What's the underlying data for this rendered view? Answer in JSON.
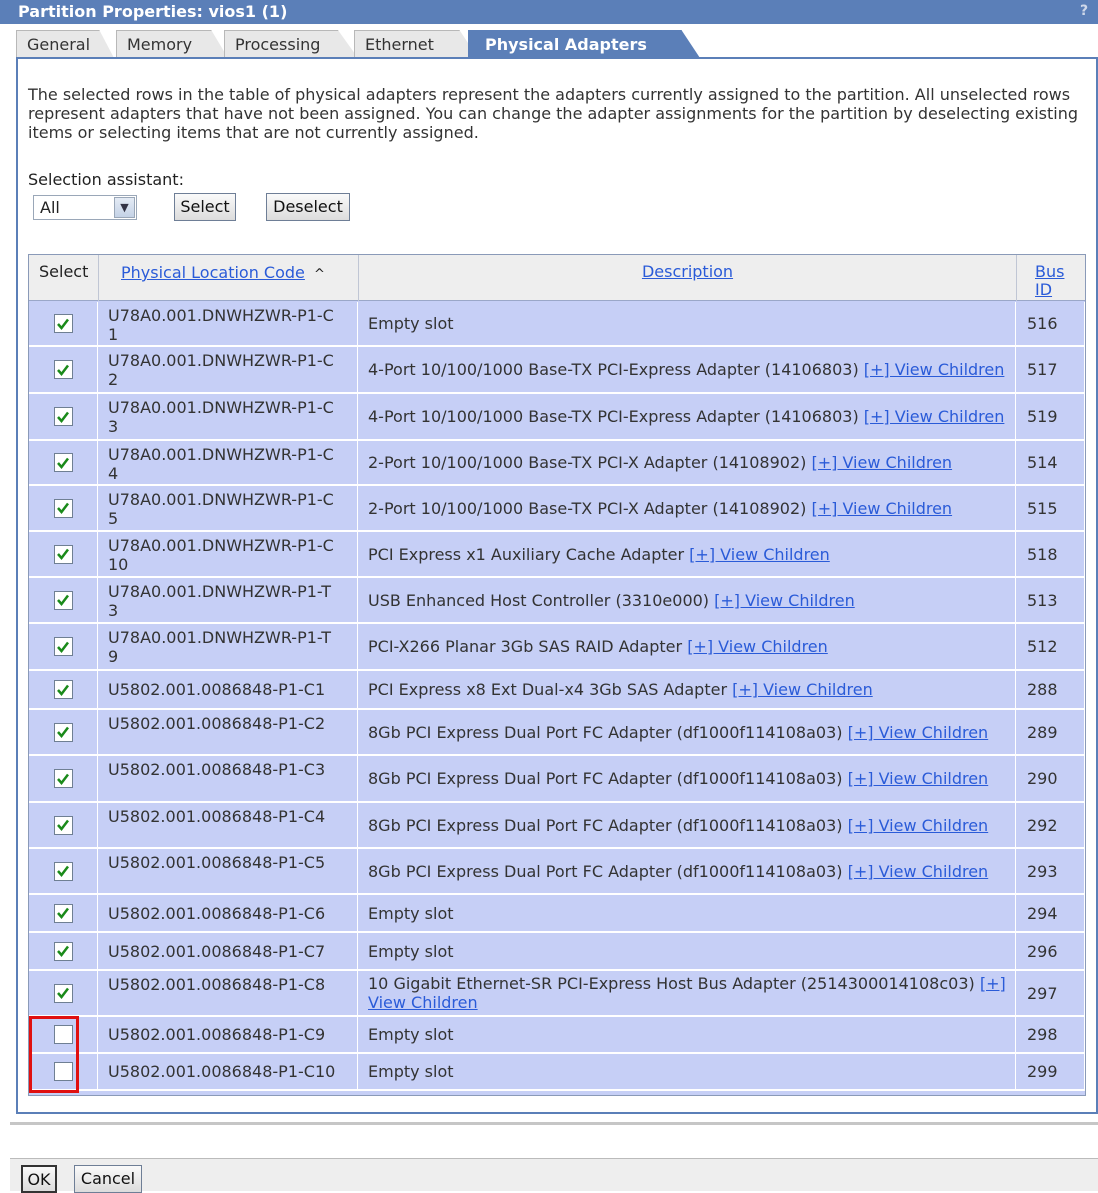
{
  "window": {
    "title": "Partition Properties: vios1 (1)",
    "help": "?"
  },
  "tabs": [
    "General",
    "Memory",
    "Processing",
    "Ethernet",
    "Physical Adapters"
  ],
  "intro": "The selected rows in the table of physical adapters represent the adapters currently assigned to the partition. All unselected rows represent adapters that have not been assigned. You can change the adapter assignments for the partition by deselecting existing items or selecting items that are not currently assigned.",
  "selection": {
    "label": "Selection assistant:",
    "value": "All",
    "select_btn": "Select",
    "deselect_btn": "Deselect"
  },
  "table": {
    "headers": {
      "select": "Select",
      "location": "Physical Location Code",
      "sort_indicator": "^",
      "description": "Description",
      "bus": "Bus ID"
    },
    "view_link": "[+] View Children",
    "rows": [
      {
        "loc": "U78A0.001.DNWHZWR-P1-C1",
        "desc": "Empty slot",
        "link": false,
        "bus": "516",
        "checked": true
      },
      {
        "loc": "U78A0.001.DNWHZWR-P1-C2",
        "desc": "4-Port 10/100/1000 Base-TX PCI-Express Adapter (14106803)",
        "link": true,
        "bus": "517",
        "checked": true
      },
      {
        "loc": "U78A0.001.DNWHZWR-P1-C3",
        "desc": "4-Port 10/100/1000 Base-TX PCI-Express Adapter (14106803)",
        "link": true,
        "bus": "519",
        "checked": true
      },
      {
        "loc": "U78A0.001.DNWHZWR-P1-C4",
        "desc": "2-Port 10/100/1000 Base-TX PCI-X Adapter (14108902)",
        "link": true,
        "bus": "514",
        "checked": true
      },
      {
        "loc": "U78A0.001.DNWHZWR-P1-C5",
        "desc": "2-Port 10/100/1000 Base-TX PCI-X Adapter (14108902)",
        "link": true,
        "bus": "515",
        "checked": true
      },
      {
        "loc": "U78A0.001.DNWHZWR-P1-C10",
        "desc": "PCI Express x1 Auxiliary Cache Adapter",
        "link": true,
        "bus": "518",
        "checked": true
      },
      {
        "loc": "U78A0.001.DNWHZWR-P1-T3",
        "desc": "USB Enhanced Host Controller (3310e000)",
        "link": true,
        "bus": "513",
        "checked": true
      },
      {
        "loc": "U78A0.001.DNWHZWR-P1-T9",
        "desc": "PCI-X266 Planar 3Gb SAS RAID Adapter",
        "link": true,
        "bus": "512",
        "checked": true
      },
      {
        "loc": "U5802.001.0086848-P1-C1",
        "desc": "PCI Express x8 Ext Dual-x4 3Gb SAS Adapter",
        "link": true,
        "bus": "288",
        "checked": true
      },
      {
        "loc": "U5802.001.0086848-P1-C2",
        "desc": "8Gb PCI Express Dual Port FC Adapter (df1000f114108a03)",
        "link": true,
        "bus": "289",
        "checked": true
      },
      {
        "loc": "U5802.001.0086848-P1-C3",
        "desc": "8Gb PCI Express Dual Port FC Adapter (df1000f114108a03)",
        "link": true,
        "bus": "290",
        "checked": true
      },
      {
        "loc": "U5802.001.0086848-P1-C4",
        "desc": "8Gb PCI Express Dual Port FC Adapter (df1000f114108a03)",
        "link": true,
        "bus": "292",
        "checked": true
      },
      {
        "loc": "U5802.001.0086848-P1-C5",
        "desc": "8Gb PCI Express Dual Port FC Adapter (df1000f114108a03)",
        "link": true,
        "bus": "293",
        "checked": true
      },
      {
        "loc": "U5802.001.0086848-P1-C6",
        "desc": "Empty slot",
        "link": false,
        "bus": "294",
        "checked": true
      },
      {
        "loc": "U5802.001.0086848-P1-C7",
        "desc": "Empty slot",
        "link": false,
        "bus": "296",
        "checked": true
      },
      {
        "loc": "U5802.001.0086848-P1-C8",
        "desc": "10 Gigabit Ethernet-SR PCI-Express Host Bus Adapter (2514300014108c03)",
        "link": true,
        "bus": "297",
        "checked": true
      },
      {
        "loc": "U5802.001.0086848-P1-C9",
        "desc": "Empty slot",
        "link": false,
        "bus": "298",
        "checked": false
      },
      {
        "loc": "U5802.001.0086848-P1-C10",
        "desc": "Empty slot",
        "link": false,
        "bus": "299",
        "checked": false
      }
    ]
  },
  "buttons": {
    "ok": "OK",
    "cancel": "Cancel"
  }
}
